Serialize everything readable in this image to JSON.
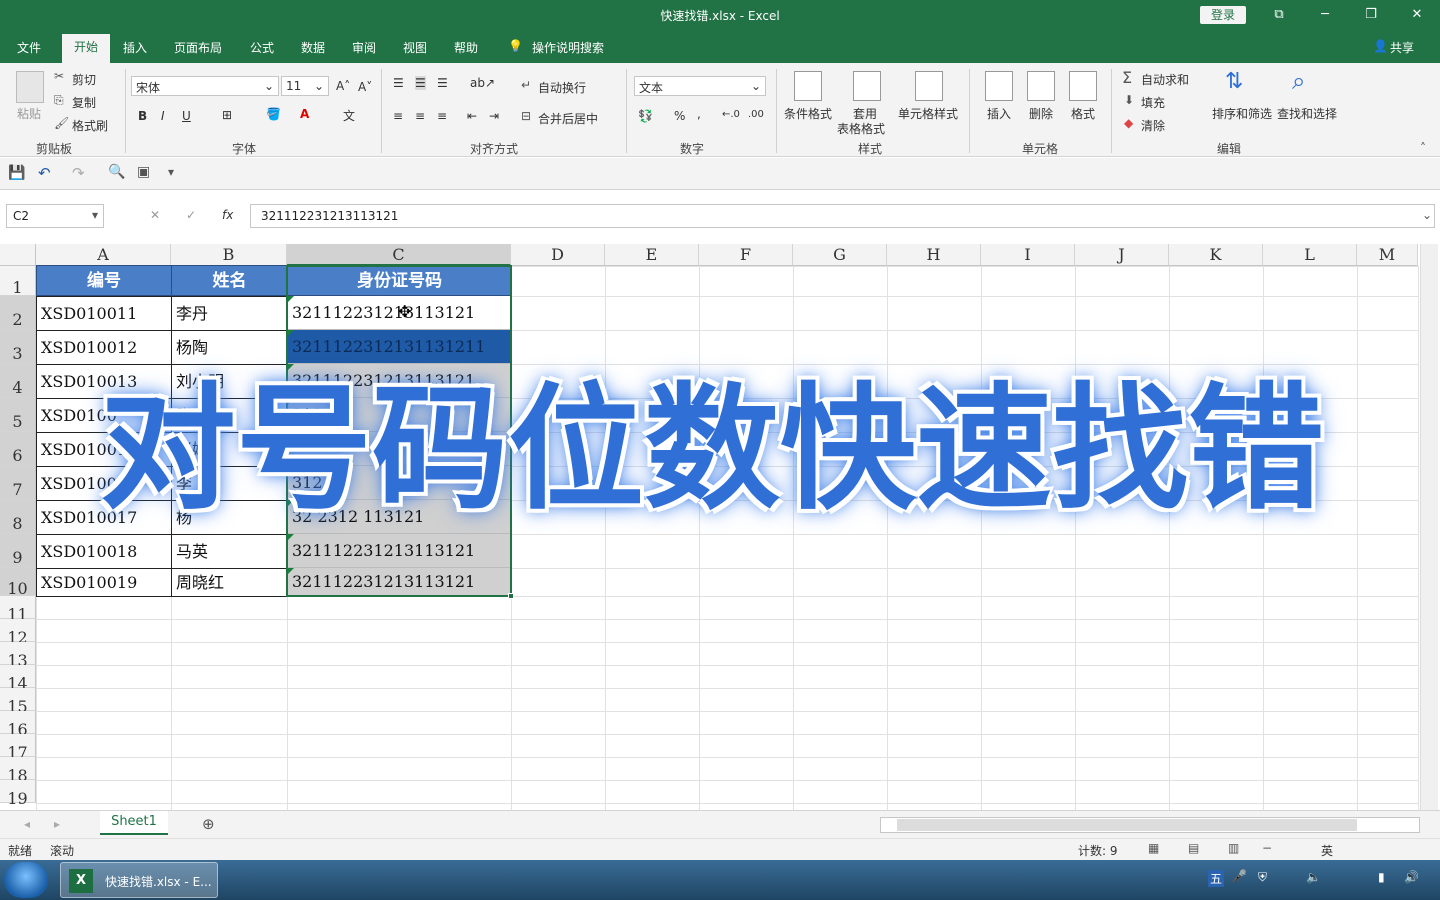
{
  "title_bar": {
    "title": "快速找错.xlsx  -  Excel",
    "login": "登录",
    "win_icons": [
      "⧉",
      "─",
      "❐",
      "✕"
    ]
  },
  "menu": {
    "tabs": [
      "文件",
      "开始",
      "插入",
      "页面布局",
      "公式",
      "数据",
      "审阅",
      "视图",
      "帮助"
    ],
    "tell_me": "操作说明搜索",
    "share": "共享"
  },
  "ribbon": {
    "clipboard": {
      "paste": "粘贴",
      "cut": "剪切",
      "copy": "复制",
      "format_painter": "格式刷",
      "label": "剪贴板"
    },
    "font": {
      "name": "宋体",
      "size": "11",
      "label": "字体",
      "bold": "B",
      "italic": "I",
      "underline": "U"
    },
    "alignment": {
      "wrap": "自动换行",
      "merge": "合并后居中",
      "label": "对齐方式"
    },
    "number": {
      "format": "文本",
      "label": "数字",
      "percent": "%"
    },
    "styles": {
      "conditional": "条件格式",
      "table1": "套用",
      "table2": "表格格式",
      "cell_styles": "单元格样式",
      "label": "样式"
    },
    "cells": {
      "insert": "插入",
      "delete": "删除",
      "format": "格式",
      "label": "单元格"
    },
    "editing": {
      "autosum": "自动求和",
      "fill": "填充",
      "clear": "清除",
      "sort": "排序和筛选",
      "find": "查找和选择",
      "label": "编辑"
    }
  },
  "formula_bar": {
    "name_box": "C2",
    "fx": "fx",
    "value": "321112231213113121"
  },
  "columns": [
    "A",
    "B",
    "C",
    "D",
    "E",
    "F",
    "G",
    "H",
    "I",
    "J",
    "K",
    "L",
    "M"
  ],
  "rows": [
    "1",
    "2",
    "3",
    "4",
    "5",
    "6",
    "7",
    "8",
    "9",
    "10",
    "11",
    "12",
    "13",
    "14",
    "15",
    "16",
    "17",
    "18",
    "19"
  ],
  "table": {
    "headers": [
      "编号",
      "姓名",
      "身份证号码"
    ],
    "rows": [
      {
        "id": "XSD010011",
        "name": "李丹",
        "idnum": "321112231213113121"
      },
      {
        "id": "XSD010012",
        "name": "杨陶",
        "idnum": "3211122312131131211"
      },
      {
        "id": "XSD010013",
        "name": "刘小明",
        "idnum": "321112231213113121"
      },
      {
        "id": "XSD0100",
        "name": "张青",
        "idnum": "312"
      },
      {
        "id": "XSD01001",
        "name": "张娟",
        "idnum": ""
      },
      {
        "id": "XSD01001",
        "name": "李",
        "idnum": "312"
      },
      {
        "id": "XSD010017",
        "name": "杨",
        "idnum": "32    2312   113121"
      },
      {
        "id": "XSD010018",
        "name": "马英",
        "idnum": "321112231213113121"
      },
      {
        "id": "XSD010019",
        "name": "周晓红",
        "idnum": "321112231213113121"
      }
    ]
  },
  "overlay_title": "对号码位数快速找错",
  "sheet": {
    "tab": "Sheet1"
  },
  "status": {
    "ready": "就绪",
    "scroll": "滚动",
    "count": "计数: 9",
    "ime1": "英"
  },
  "taskbar": {
    "app": "快速找错.xlsx - E...",
    "ime": "五"
  },
  "colors": {
    "excel_green": "#217346",
    "header_blue": "#4a7fc8",
    "selected_blue": "#1f5aa6",
    "overlay_blue": "#2f6fd6"
  }
}
